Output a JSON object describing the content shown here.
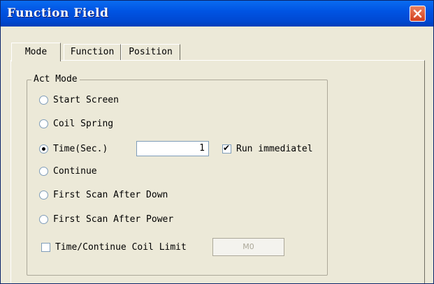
{
  "window": {
    "title": "Function Field"
  },
  "tabs": [
    {
      "label": "Mode",
      "selected": true
    },
    {
      "label": "Function",
      "selected": false
    },
    {
      "label": "Position",
      "selected": false
    }
  ],
  "act_mode": {
    "group_title": "Act Mode",
    "options": [
      {
        "label": "Start Screen",
        "checked": false
      },
      {
        "label": "Coil Spring",
        "checked": false
      },
      {
        "label": "Time(Sec.)",
        "checked": true
      },
      {
        "label": "Continue",
        "checked": false
      },
      {
        "label": "First Scan After Down",
        "checked": false
      },
      {
        "label": "First Scan After Power",
        "checked": false
      }
    ],
    "time_value": "1",
    "run_immediately": {
      "label": "Run immediatel",
      "checked": true
    },
    "coil_limit": {
      "label": "Time/Continue Coil Limit",
      "checked": false
    },
    "coil_limit_button": "M0"
  },
  "colors": {
    "titlebar": "#0054e3",
    "dialog_bg": "#ece9d8",
    "close_button": "#d5411f"
  },
  "icons": {
    "close": "close-x-icon"
  }
}
